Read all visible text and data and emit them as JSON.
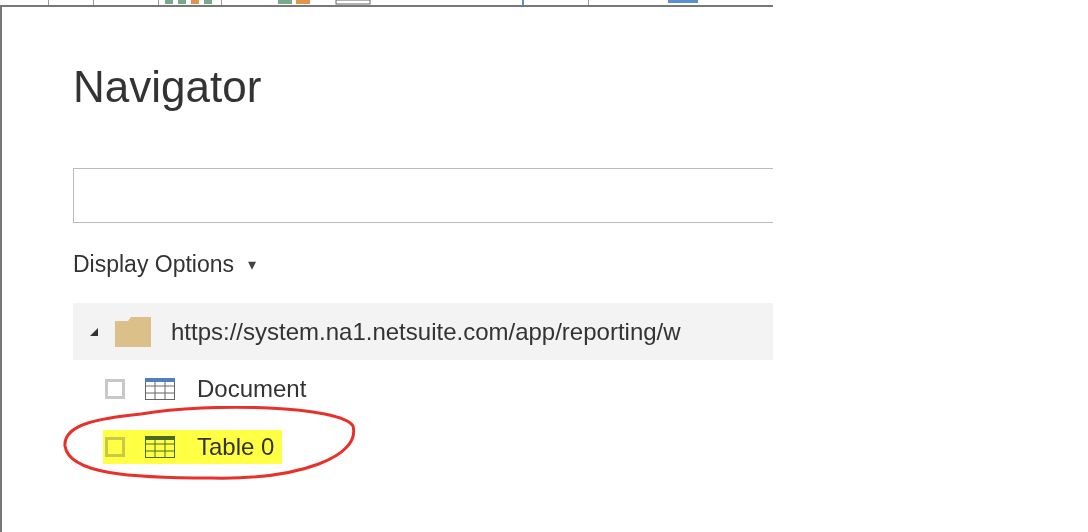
{
  "dialog": {
    "title": "Navigator"
  },
  "display_options": {
    "label": "Display Options",
    "caret": "▾"
  },
  "tree": {
    "label": "https://system.na1.netsuite.com/app/reporting/w",
    "expanded": true,
    "children": [
      {
        "label": "Document",
        "checked": false,
        "highlighted": false
      },
      {
        "label": "Table 0",
        "checked": false,
        "highlighted": true
      }
    ]
  }
}
